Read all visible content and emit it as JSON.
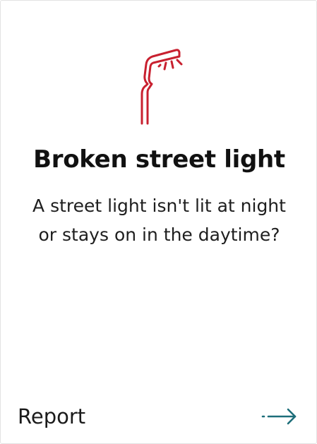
{
  "card": {
    "icon": "street-light-icon",
    "icon_color": "#c8202f",
    "title": "Broken street light",
    "description": "A street light isn't lit at night or stays on in the daytime?",
    "action": {
      "label": "Report",
      "icon": "arrow-right-icon",
      "icon_color": "#1d6e7a"
    }
  }
}
